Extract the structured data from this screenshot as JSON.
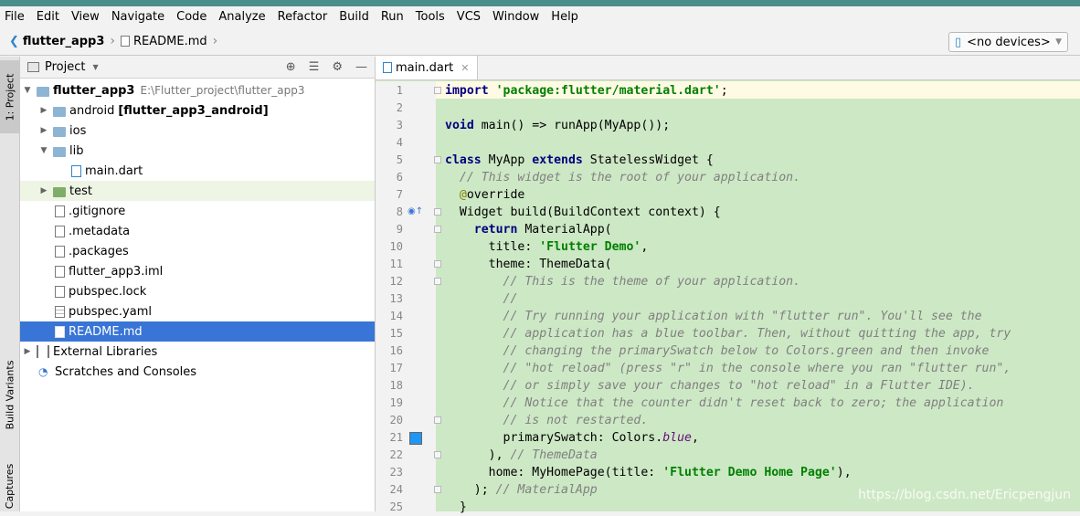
{
  "menubar": {
    "items": [
      "File",
      "Edit",
      "View",
      "Navigate",
      "Code",
      "Analyze",
      "Refactor",
      "Build",
      "Run",
      "Tools",
      "VCS",
      "Window",
      "Help"
    ]
  },
  "navbar": {
    "project": "flutter_app3",
    "file": "README.md",
    "device": "<no devices>"
  },
  "left_strip": {
    "project_tab": "1: Project",
    "build_variants_tab": "Build Variants",
    "captures_tab": "Captures"
  },
  "project_panel": {
    "title": "Project",
    "tree": [
      {
        "label": "flutter_app3",
        "path": "E:\\Flutter_project\\flutter_app3"
      },
      {
        "label": "android",
        "suffix": "[flutter_app3_android]"
      },
      {
        "label": "ios"
      },
      {
        "label": "lib"
      },
      {
        "label": "main.dart"
      },
      {
        "label": "test"
      },
      {
        "label": ".gitignore"
      },
      {
        "label": ".metadata"
      },
      {
        "label": ".packages"
      },
      {
        "label": "flutter_app3.iml"
      },
      {
        "label": "pubspec.lock"
      },
      {
        "label": "pubspec.yaml"
      },
      {
        "label": "README.md"
      },
      {
        "label": "External Libraries"
      },
      {
        "label": "Scratches and Consoles"
      }
    ]
  },
  "editor": {
    "tab": "main.dart",
    "line_numbers": [
      "1",
      "2",
      "3",
      "4",
      "5",
      "6",
      "7",
      "8",
      "9",
      "10",
      "11",
      "12",
      "13",
      "14",
      "15",
      "16",
      "17",
      "18",
      "19",
      "20",
      "21",
      "22",
      "23",
      "24",
      "25"
    ],
    "code": {
      "l1_kw": "import",
      "l1_str": "'package:flutter/material.dart'",
      "l1_rest": ";",
      "l3_kw": "void",
      "l3_rest": " main() => runApp(MyApp());",
      "l5_kw1": "class",
      "l5_mid": " MyApp ",
      "l5_kw2": "extends",
      "l5_rest": " StatelessWidget {",
      "l6": "  // This widget is the root of your application.",
      "l7_an": "  @",
      "l7_rest": "override",
      "l8": "  Widget build(BuildContext context) {",
      "l9_kw": "    return",
      "l9_rest": " MaterialApp(",
      "l10_a": "      title: ",
      "l10_str": "'Flutter Demo'",
      "l10_b": ",",
      "l11": "      theme: ThemeData(",
      "l12": "        // This is the theme of your application.",
      "l13": "        //",
      "l14": "        // Try running your application with \"flutter run\". You'll see the",
      "l15": "        // application has a blue toolbar. Then, without quitting the app, try",
      "l16": "        // changing the primarySwatch below to Colors.green and then invoke",
      "l17": "        // \"hot reload\" (press \"r\" in the console where you ran \"flutter run\",",
      "l18": "        // or simply save your changes to \"hot reload\" in a Flutter IDE).",
      "l19": "        // Notice that the counter didn't reset back to zero; the application",
      "l20": "        // is not restarted.",
      "l21_a": "        primarySwatch: Colors.",
      "l21_it": "blue",
      "l21_b": ",",
      "l22_a": "      ), ",
      "l22_cm": "// ThemeData",
      "l23_a": "      home: MyHomePage(title: ",
      "l23_str": "'Flutter Demo Home Page'",
      "l23_b": "),",
      "l24_a": "    ); ",
      "l24_cm": "// MaterialApp",
      "l25": "  }"
    },
    "watermark": "https://blog.csdn.net/Ericpengjun"
  },
  "colors": {
    "editor_highlight": "#cde8c5",
    "selection": "#3875d6",
    "swatch_blue": "#2196f3",
    "titlebar": "#4b8f8c"
  }
}
